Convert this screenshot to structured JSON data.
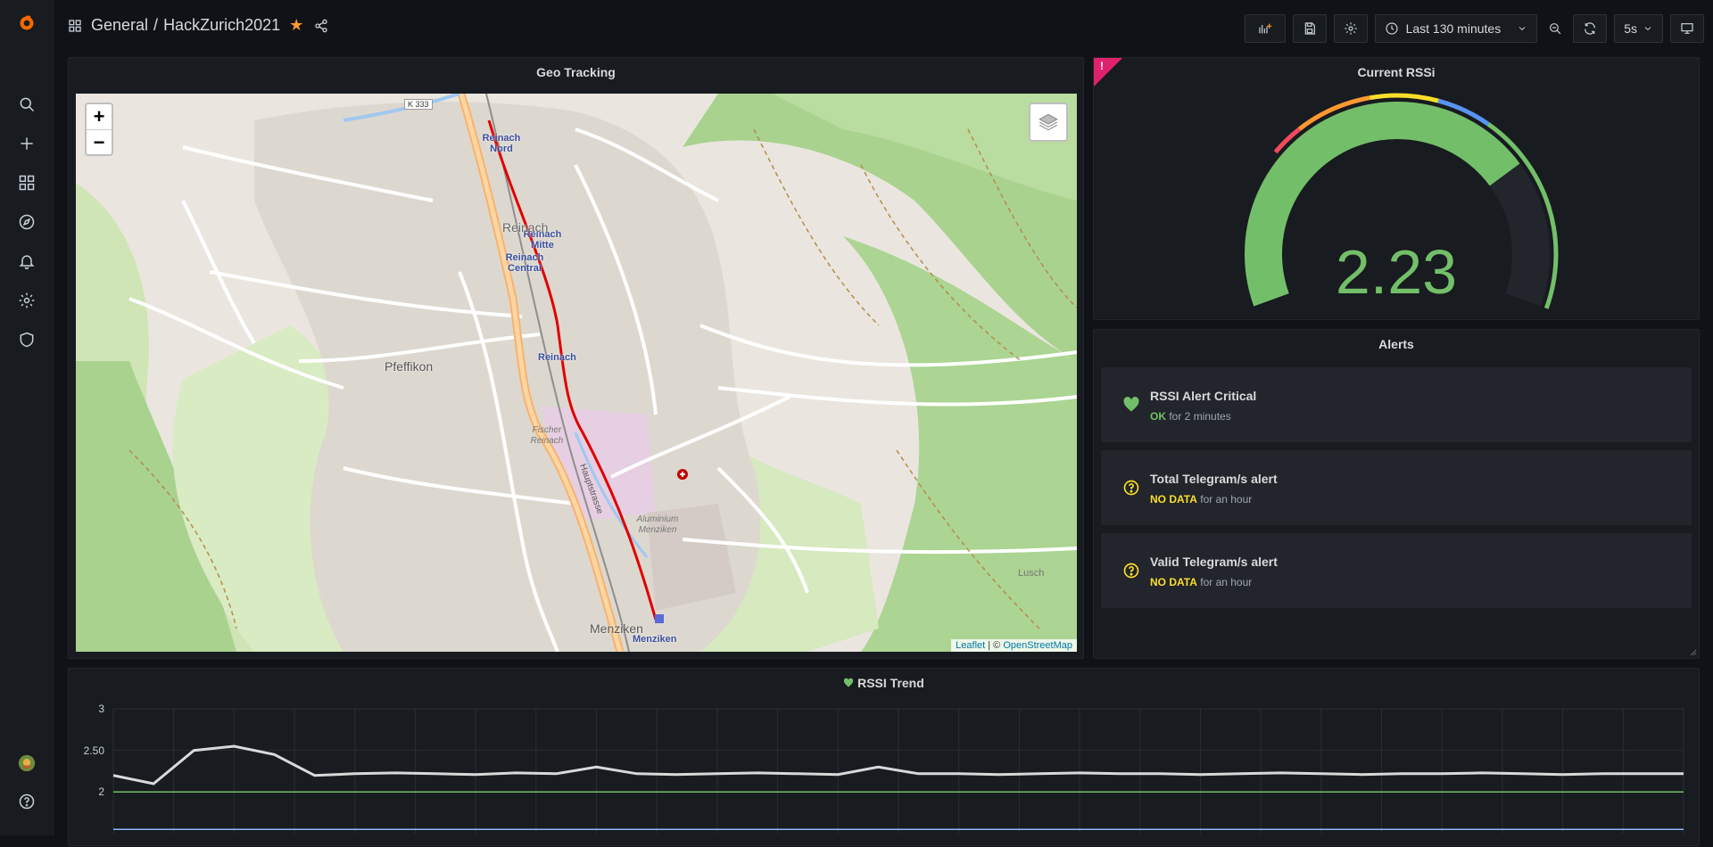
{
  "header": {
    "folder": "General",
    "dashboard": "HackZurich2021",
    "time_range": "Last 130 minutes",
    "refresh": "5s"
  },
  "geo_panel": {
    "title": "Geo Tracking",
    "zoom_in": "+",
    "zoom_out": "−",
    "attribution_leaflet": "Leaflet",
    "attribution_sep": " | © ",
    "attribution_osm": "OpenStreetMap",
    "labels": {
      "reinach_nord": "Reinach Nord",
      "reinach_mitte": "Reinach Mitte",
      "reinach_central": "Reinach Central",
      "reinach": "Reinach",
      "reinach_station": "Reinach",
      "pfeffikon": "Pfeffikon",
      "menziken": "Menziken",
      "menziken_station": "Menziken",
      "fischer": "Fischer Reinach",
      "aluminium": "Aluminium Menziken",
      "lusch": "Lusch",
      "k333": "K 333",
      "hauptstrasse": "Hauptstrasse"
    }
  },
  "gauge_panel": {
    "title": "Current RSSi",
    "value": "2.23",
    "value_num": 2.23,
    "min": 0,
    "max": 3,
    "colors": {
      "fill": "#73bf69",
      "red": "#f2495c",
      "orange": "#ff9830",
      "yellow": "#fade2a",
      "blue": "#5794f2",
      "green": "#73bf69"
    }
  },
  "alerts_panel": {
    "title": "Alerts",
    "items": [
      {
        "name": "RSSI Alert Critical",
        "state": "OK",
        "duration": "for 2 minutes",
        "icon": "heart-icon",
        "color": "#73bf69"
      },
      {
        "name": "Total Telegram/s alert",
        "state": "NO DATA",
        "duration": "for an hour",
        "icon": "question-icon",
        "color": "#fade2a"
      },
      {
        "name": "Valid Telegram/s alert",
        "state": "NO DATA",
        "duration": "for an hour",
        "icon": "question-icon",
        "color": "#fade2a"
      }
    ]
  },
  "trend_panel": {
    "title": "RSSI Trend",
    "y_ticks": [
      "3",
      "2.50",
      "2"
    ]
  },
  "chart_data": {
    "type": "line",
    "title": "RSSI Trend",
    "xlabel": "",
    "ylabel": "",
    "ylim": [
      1.5,
      3
    ],
    "y_ticks": [
      3,
      2.5,
      2
    ],
    "grid": true,
    "series": [
      {
        "values": [
          2.2,
          2.1,
          2.5,
          2.55,
          2.45,
          2.2,
          2.22,
          2.23,
          2.22,
          2.21,
          2.23,
          2.22,
          2.3,
          2.22,
          2.21,
          2.22,
          2.23,
          2.22,
          2.21,
          2.3,
          2.22,
          2.22,
          2.21,
          2.22,
          2.23,
          2.22,
          2.22,
          2.21,
          2.22,
          2.23,
          2.22,
          2.21,
          2.22,
          2.22,
          2.23,
          2.22,
          2.21,
          2.22,
          2.22,
          2.22
        ],
        "color": "#d8d9da"
      },
      {
        "values": [
          2,
          2
        ],
        "color": "#73bf69"
      },
      {
        "values": [
          1.55,
          1.55
        ],
        "color": "#8ab8ff"
      }
    ]
  }
}
